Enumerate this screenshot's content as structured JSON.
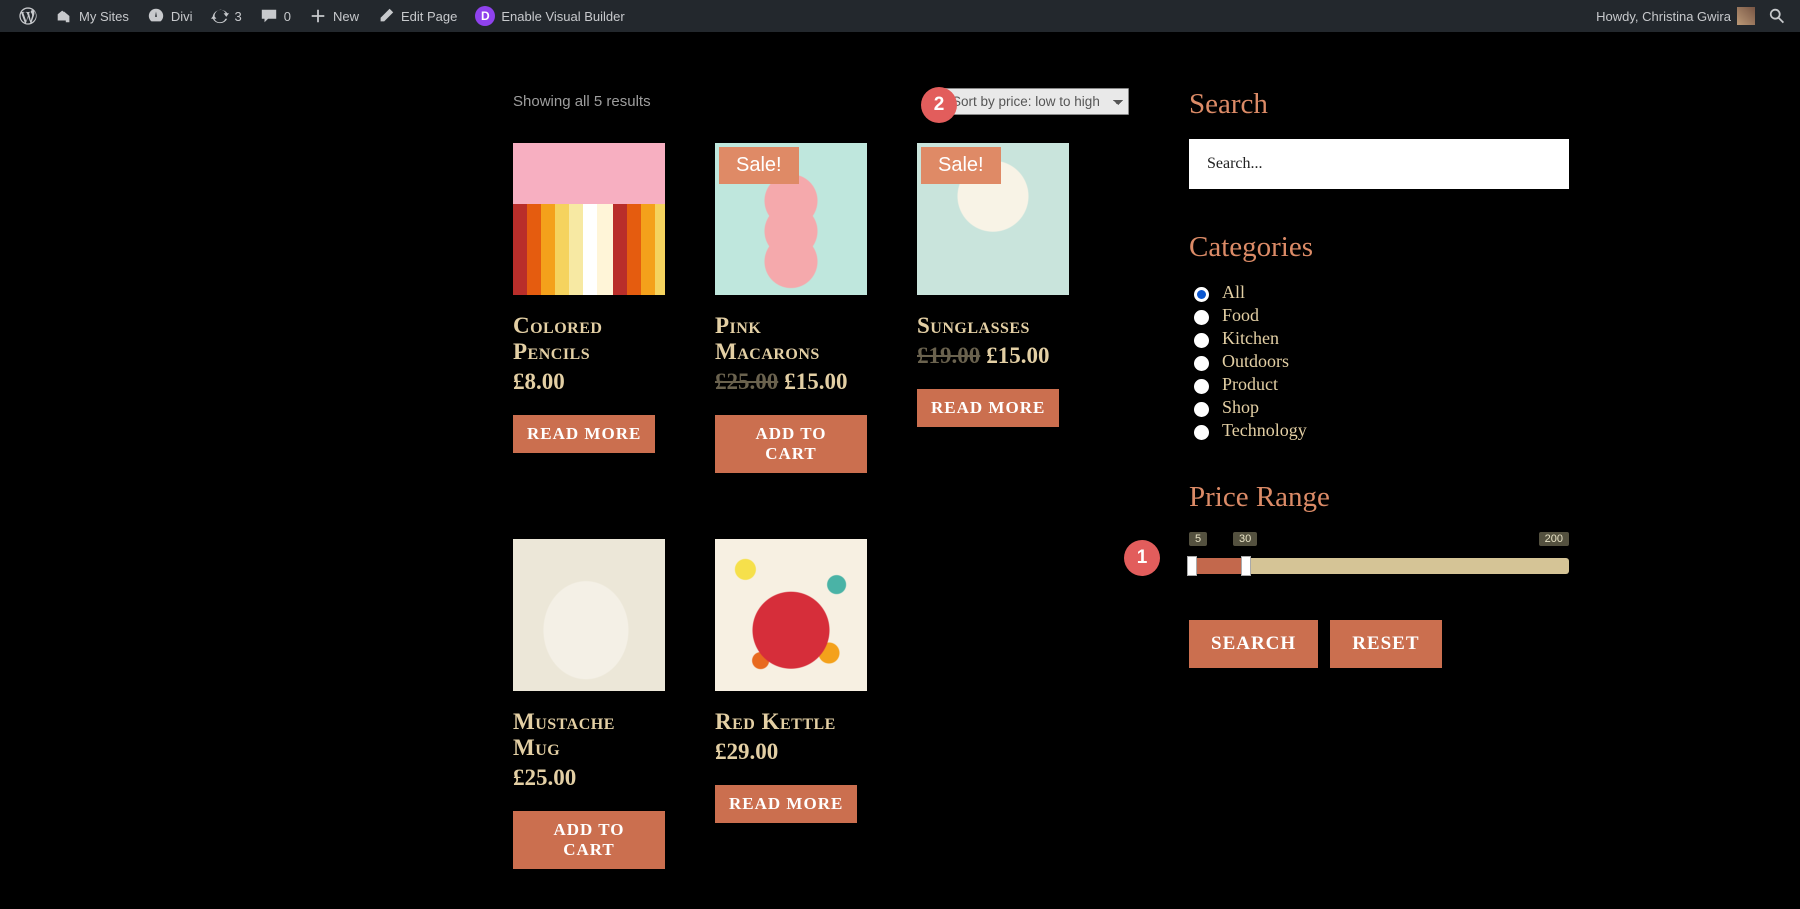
{
  "admin_bar": {
    "my_sites": "My Sites",
    "site_name": "Divi",
    "refresh_count": "3",
    "comments_count": "0",
    "new": "New",
    "edit_page": "Edit Page",
    "visual_builder": "Enable Visual Builder",
    "howdy_prefix": "Howdy, ",
    "user_name": "Christina Gwira"
  },
  "markers": {
    "one": "1",
    "two": "2"
  },
  "results_text": "Showing all 5 results",
  "sort_selected": "Sort by price: low to high",
  "sale_label": "Sale!",
  "products": [
    {
      "title": "Colored Pencils",
      "price": "£8.00",
      "old_price": "",
      "sale": false,
      "button": "READ MORE",
      "img": "img-pencils"
    },
    {
      "title": "Pink Macarons",
      "price": "£15.00",
      "old_price": "£25.00",
      "sale": true,
      "button": "ADD TO CART",
      "img": "img-macarons"
    },
    {
      "title": "Sunglasses",
      "price": "£15.00",
      "old_price": "£19.00",
      "sale": true,
      "button": "READ MORE",
      "img": "img-sunglasses"
    },
    {
      "title": "Mustache Mug",
      "price": "£25.00",
      "old_price": "",
      "sale": false,
      "button": "ADD TO CART",
      "img": "img-mug"
    },
    {
      "title": "Red Kettle",
      "price": "£29.00",
      "old_price": "",
      "sale": false,
      "button": "READ MORE",
      "img": "img-kettle"
    }
  ],
  "sidebar": {
    "search_heading": "Search",
    "search_placeholder": "Search...",
    "categories_heading": "Categories",
    "categories": [
      "All",
      "Food",
      "Kitchen",
      "Outdoors",
      "Product",
      "Shop",
      "Technology"
    ],
    "selected_category": "All",
    "price_heading": "Price Range",
    "slider": {
      "min_label": "5",
      "mid_label": "30",
      "max_label": "200",
      "fill_percent": 15,
      "handle1_percent": 0,
      "handle2_percent": 15
    },
    "search_button": "SEARCH",
    "reset_button": "RESET"
  }
}
